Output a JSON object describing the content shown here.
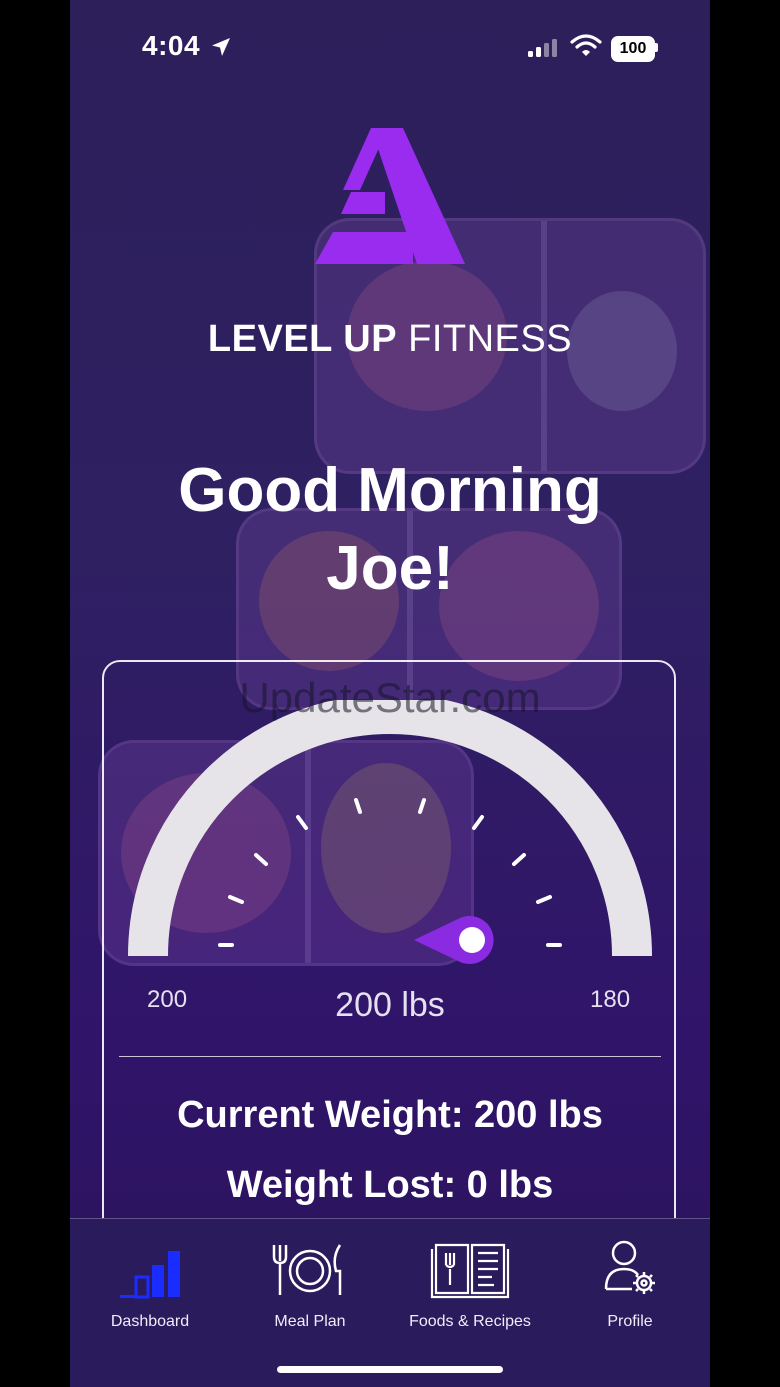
{
  "status_bar": {
    "time": "4:04",
    "battery": "100"
  },
  "brand": {
    "bold": "LEVEL UP",
    "light": "FITNESS"
  },
  "greeting": {
    "line1": "Good Morning",
    "line2": "Joe!"
  },
  "watermark": "UpdateStar.com",
  "weight_gauge": {
    "start_label": "200",
    "goal_label": "180",
    "current_label": "200 lbs",
    "progress": 0
  },
  "stats": {
    "current_weight": "Current Weight: 200 lbs",
    "weight_lost": "Weight Lost: 0 lbs"
  },
  "tabs": [
    {
      "label": "Dashboard",
      "icon": "bar-chart-icon"
    },
    {
      "label": "Meal Plan",
      "icon": "plate-utensils-icon"
    },
    {
      "label": "Foods & Recipes",
      "icon": "recipe-book-icon"
    },
    {
      "label": "Profile",
      "icon": "user-settings-icon"
    }
  ],
  "colors": {
    "accent": "#8a2be2",
    "active_tab": "#1a2cff",
    "gauge_track": "#e6e4e8"
  }
}
